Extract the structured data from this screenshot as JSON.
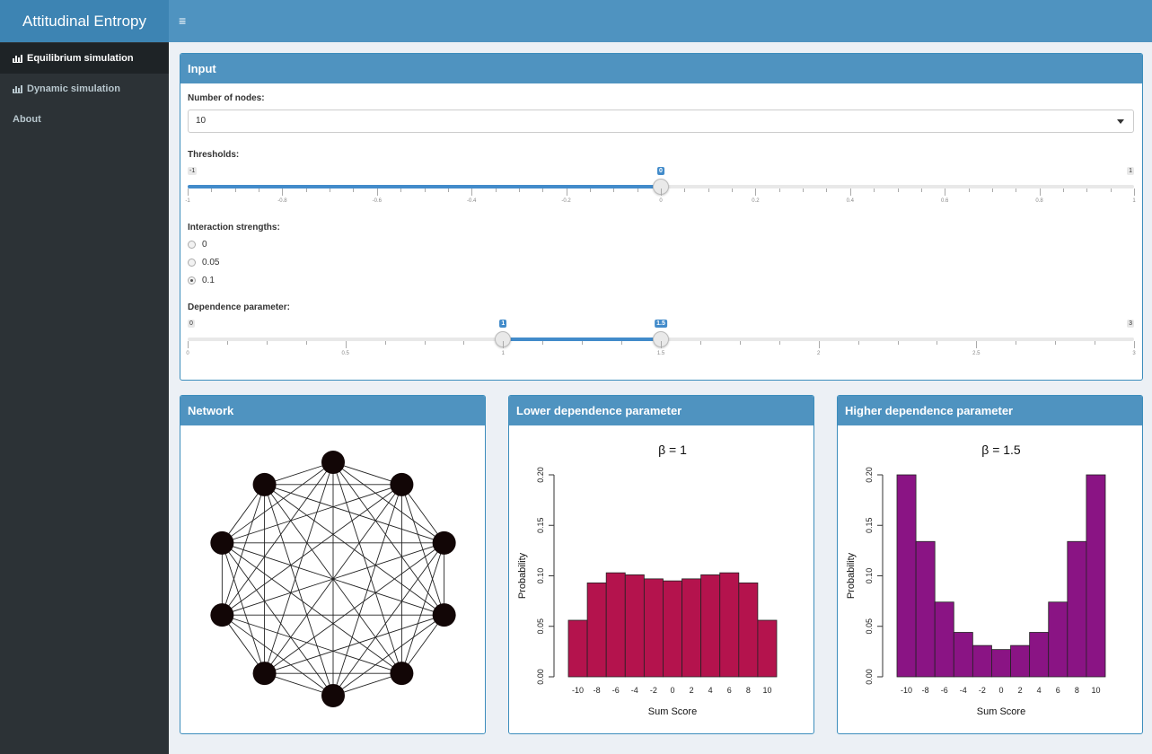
{
  "app": {
    "title": "Attitudinal Entropy",
    "menu_icon": "hamburger-icon"
  },
  "sidebar": {
    "items": [
      {
        "label": "Equilibrium simulation",
        "icon": "bar-chart-icon",
        "active": true
      },
      {
        "label": "Dynamic simulation",
        "icon": "bar-chart-icon",
        "active": false
      },
      {
        "label": "About",
        "icon": "",
        "active": false
      }
    ]
  },
  "input": {
    "title": "Input",
    "nodes": {
      "label": "Number of nodes:",
      "value": "10"
    },
    "thresholds": {
      "label": "Thresholds:",
      "min": -1,
      "max": 1,
      "value": 0,
      "min_label": "-1",
      "max_label": "1",
      "value_label": "0",
      "ticks": [
        "-1",
        "-0.8",
        "-0.6",
        "-0.4",
        "-0.2",
        "0",
        "0.2",
        "0.4",
        "0.6",
        "0.8",
        "1"
      ]
    },
    "interaction": {
      "label": "Interaction strengths:",
      "options": [
        "0",
        "0.05",
        "0.1"
      ],
      "selected": "0.1"
    },
    "dependence": {
      "label": "Dependence parameter:",
      "min": 0,
      "max": 3,
      "from": 1,
      "to": 1.5,
      "min_label": "0",
      "max_label": "3",
      "from_label": "1",
      "to_label": "1.5",
      "ticks": [
        "0",
        "0.5",
        "1",
        "1.5",
        "2",
        "2.5",
        "3"
      ]
    }
  },
  "network": {
    "title": "Network",
    "nodes": 10
  },
  "lower": {
    "title": "Lower dependence parameter",
    "plot_title": "β = 1"
  },
  "higher": {
    "title": "Higher dependence parameter",
    "plot_title": "β = 1.5"
  },
  "chart_data": [
    {
      "type": "bar",
      "title": "β = 1",
      "xlabel": "Sum Score",
      "ylabel": "Probability",
      "categories": [
        "-10",
        "-8",
        "-6",
        "-4",
        "-2",
        "0",
        "2",
        "4",
        "6",
        "8",
        "10"
      ],
      "values": [
        0.056,
        0.093,
        0.103,
        0.101,
        0.097,
        0.095,
        0.097,
        0.101,
        0.103,
        0.093,
        0.056
      ],
      "ylim": [
        0,
        0.2
      ],
      "yticks": [
        "0.00",
        "0.05",
        "0.10",
        "0.15",
        "0.20"
      ],
      "color": "#b4134d"
    },
    {
      "type": "bar",
      "title": "β = 1.5",
      "xlabel": "Sum Score",
      "ylabel": "Probability",
      "categories": [
        "-10",
        "-8",
        "-6",
        "-4",
        "-2",
        "0",
        "2",
        "4",
        "6",
        "8",
        "10"
      ],
      "values": [
        0.2,
        0.134,
        0.074,
        0.044,
        0.031,
        0.027,
        0.031,
        0.044,
        0.074,
        0.134,
        0.2
      ],
      "ylim": [
        0,
        0.2
      ],
      "yticks": [
        "0.00",
        "0.05",
        "0.10",
        "0.15",
        "0.20"
      ],
      "color": "#8a1484"
    }
  ]
}
